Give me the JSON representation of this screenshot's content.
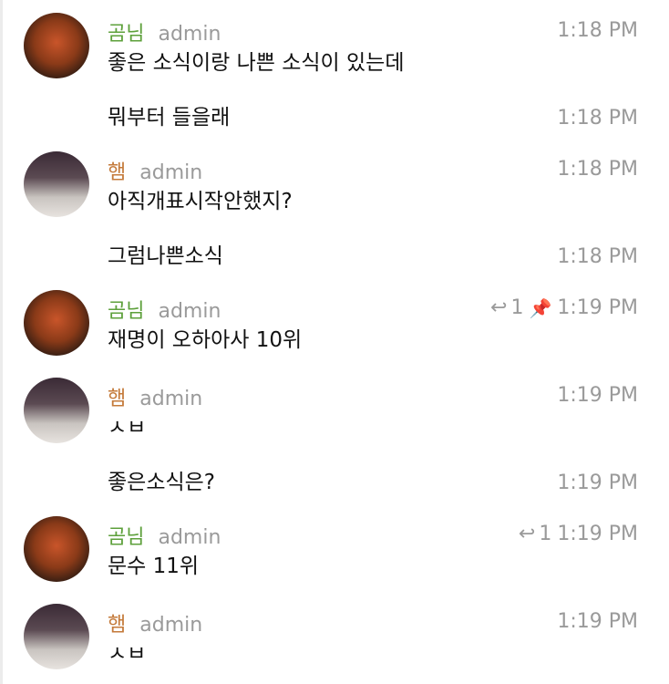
{
  "messages": [
    {
      "user": "곰님",
      "role": "admin",
      "text": "좋은 소식이랑 나쁜 소식이 있는데",
      "time": "1:18 PM"
    },
    {
      "text": "뭐부터 들을래",
      "time": "1:18 PM"
    },
    {
      "user": "햄",
      "role": "admin",
      "text": "아직개표시작안했지?",
      "time": "1:18 PM"
    },
    {
      "text": "그럼나쁜소식",
      "time": "1:18 PM"
    },
    {
      "user": "곰님",
      "role": "admin",
      "text": "재명이 오하아사 10위",
      "time": "1:19 PM",
      "replies": "1"
    },
    {
      "user": "햄",
      "role": "admin",
      "text": "ㅅㅂ",
      "time": "1:19 PM"
    },
    {
      "text": "좋은소식은?",
      "time": "1:19 PM"
    },
    {
      "user": "곰님",
      "role": "admin",
      "text": "문수 11위",
      "time": "1:19 PM",
      "replies": "1"
    },
    {
      "user": "햄",
      "role": "admin",
      "text": "ㅅㅂ",
      "time": "1:19 PM"
    }
  ],
  "icons": {
    "reply": "reply-arrow-icon",
    "pin": "pin-icon"
  },
  "colors": {
    "user1": "#5da03b",
    "user2": "#c47a3a",
    "pin": "#c8482f"
  }
}
